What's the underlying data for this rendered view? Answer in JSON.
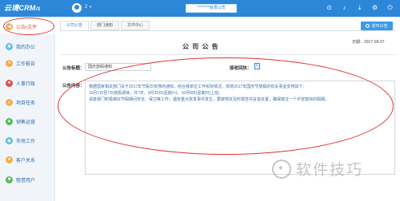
{
  "topbar": {
    "brand": "云境CRM",
    "brand_suffix": "/S",
    "username": "2",
    "company": "********有限公司",
    "icons": [
      "location-icon",
      "bell-icon",
      "download-icon",
      "settings-icon",
      "power-icon"
    ]
  },
  "sidebar": {
    "items": [
      {
        "label": "公告•文件",
        "icon": "megaphone-icon",
        "color": "#f0ad4e"
      },
      {
        "label": "我的办公",
        "icon": "gear-icon",
        "color": "#5bc0de"
      },
      {
        "label": "工作报告",
        "icon": "report-icon",
        "color": "#f0ad4e"
      },
      {
        "label": "人事行政",
        "icon": "person-icon",
        "color": "#d9534f"
      },
      {
        "label": "项目任务",
        "icon": "task-icon",
        "color": "#f0ad4e"
      },
      {
        "label": "销售运营",
        "icon": "chart-icon",
        "color": "#5cb85c"
      },
      {
        "label": "市场工作",
        "icon": "market-icon",
        "color": "#5bc0de"
      },
      {
        "label": "客户关系",
        "icon": "customer-icon",
        "color": "#f0ad4e"
      },
      {
        "label": "租借用户",
        "icon": "user-icon",
        "color": "#5cb85c"
      }
    ]
  },
  "tabs": [
    "公司公告",
    "部门通知",
    "文件中心"
  ],
  "send_button": "发布公告",
  "notice": {
    "heading": "公 司 公 告",
    "date": "日期：2017-09-07",
    "title_label": "公告标题：",
    "title_value": "国庆放假通知",
    "receipt_label": "接收回执：",
    "content_label": "公告内容：",
    "content_lines": [
      "根据国家相关部门关于2017年节假日安排的通知，结合我单位工作实际情况，现将2017年国庆节放假的有关事宜安排如下：",
      "10月1日至7日放假调休，共7天。9月30日(星期六)、10月8日(星期日)上班。",
      "请各部门积极做好节假期间安全、保卫等工作，遇有重大突发事件发生，要按规定及时报告并妥善处置，确保度过一个平安愉快的假期。"
    ]
  },
  "watermark": "软件技巧"
}
